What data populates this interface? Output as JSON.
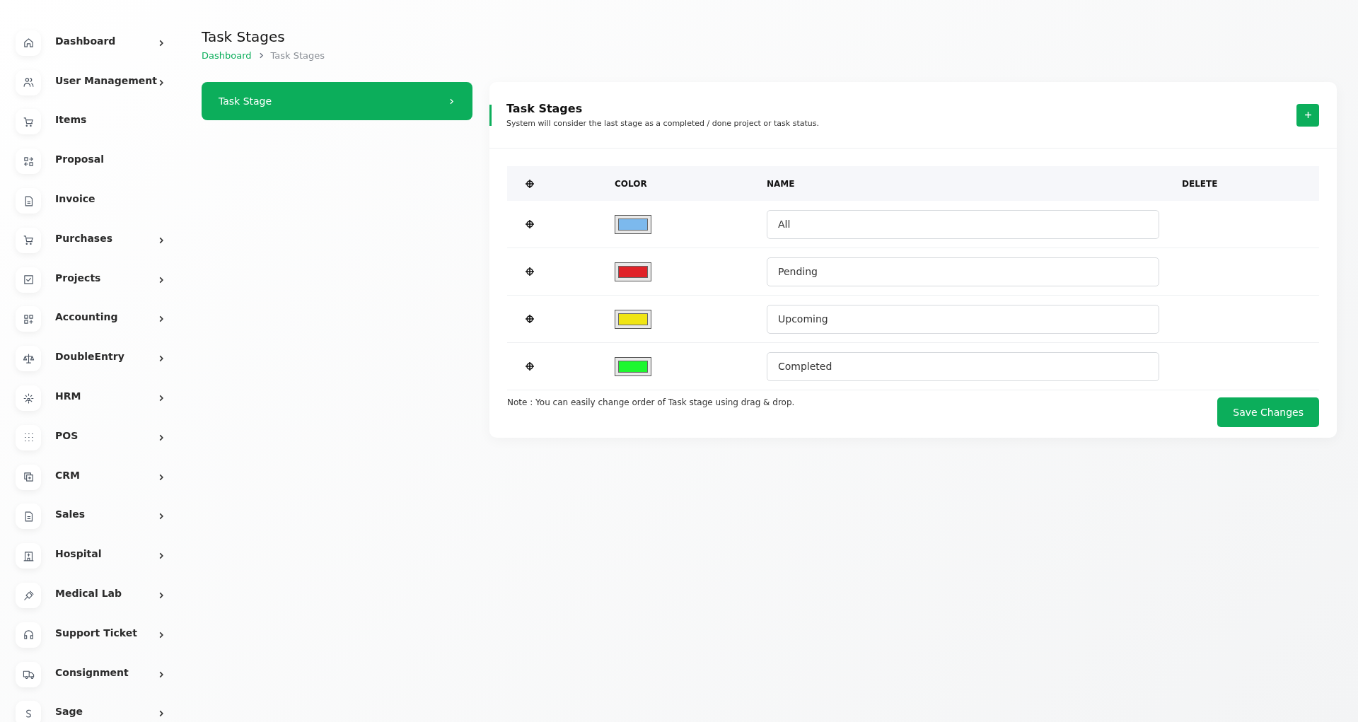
{
  "sidebar": {
    "items": [
      {
        "label": "Dashboard",
        "expandable": true
      },
      {
        "label": "User Management",
        "expandable": true
      },
      {
        "label": "Items",
        "expandable": false
      },
      {
        "label": "Proposal",
        "expandable": false
      },
      {
        "label": "Invoice",
        "expandable": false
      },
      {
        "label": "Purchases",
        "expandable": true
      },
      {
        "label": "Projects",
        "expandable": true
      },
      {
        "label": "Accounting",
        "expandable": true
      },
      {
        "label": "DoubleEntry",
        "expandable": true
      },
      {
        "label": "HRM",
        "expandable": true
      },
      {
        "label": "POS",
        "expandable": true
      },
      {
        "label": "CRM",
        "expandable": true
      },
      {
        "label": "Sales",
        "expandable": true
      },
      {
        "label": "Hospital",
        "expandable": true
      },
      {
        "label": "Medical Lab",
        "expandable": true
      },
      {
        "label": "Support Ticket",
        "expandable": true
      },
      {
        "label": "Consignment",
        "expandable": true
      },
      {
        "label": "Sage",
        "expandable": true
      }
    ]
  },
  "page": {
    "title": "Task Stages",
    "breadcrumb": [
      "Dashboard",
      "Task Stages"
    ]
  },
  "settings_menu": [
    {
      "label": "Task Stage",
      "selected": true
    }
  ],
  "card": {
    "title": "Task Stages",
    "description": "System will consider the last stage as a completed / done project or task status.",
    "table": {
      "columns": [
        "COLOR",
        "NAME",
        "DELETE"
      ],
      "rows": [
        {
          "color": "#7cb9ed",
          "name": "All"
        },
        {
          "color": "#e02228",
          "name": "Pending"
        },
        {
          "color": "#f0e514",
          "name": "Upcoming"
        },
        {
          "color": "#1ef72f",
          "name": "Completed"
        }
      ]
    },
    "note": "Note : You can easily change order of Task stage using drag & drop.",
    "save_button": "Save Changes"
  }
}
